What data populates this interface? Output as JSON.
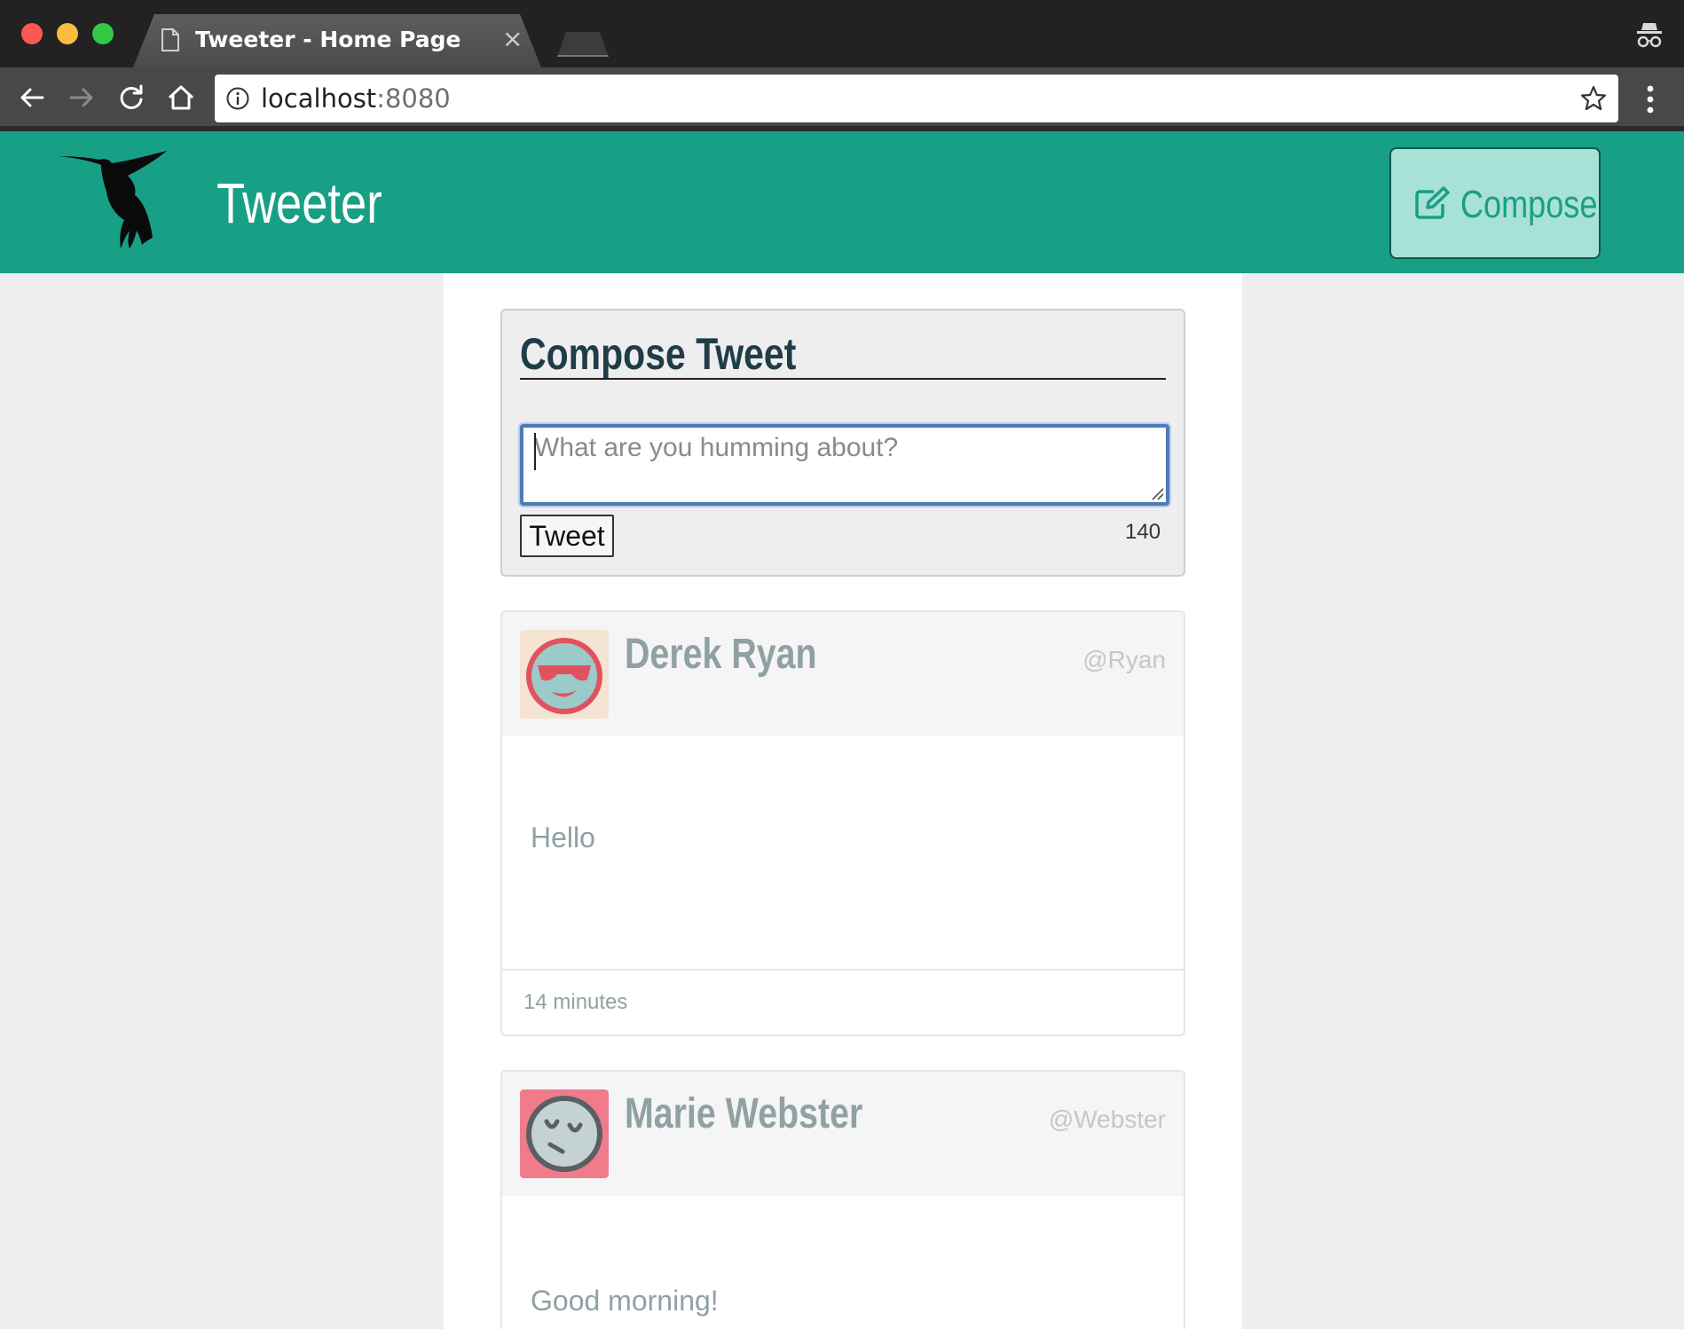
{
  "browser": {
    "tab_title": "Tweeter - Home Page",
    "tab_close": "×",
    "url_host": "localhost",
    "url_port": ":8080"
  },
  "header": {
    "brand": "Tweeter",
    "compose_label": "Compose"
  },
  "compose": {
    "title": "Compose Tweet",
    "placeholder": "What are you humming about?",
    "value": "",
    "submit_label": "Tweet",
    "counter": "140"
  },
  "tweets": [
    {
      "name": "Derek Ryan",
      "handle": "@Ryan",
      "text": "Hello",
      "time": "14 minutes",
      "avatar_icon": "cool-face-avatar-icon",
      "avatar_bg": "#f5e3d3",
      "avatar_accent": "#e0525d"
    },
    {
      "name": "Marie Webster",
      "handle": "@Webster",
      "text": "Good morning!",
      "avatar_icon": "sleepy-face-avatar-icon",
      "avatar_bg": "#f07b8b",
      "avatar_accent": "#5b5f63"
    }
  ],
  "colors": {
    "brand_teal": "#18a086",
    "compose_button_bg": "#a8e1d8",
    "title_dark": "#1e3d48",
    "tweet_text": "#8fa1a3",
    "page_bg": "#eeeeee"
  }
}
